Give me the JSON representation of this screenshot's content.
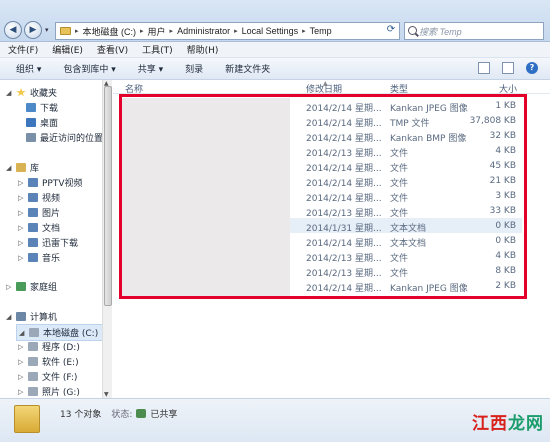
{
  "address": {
    "crumbs": [
      "本地磁盘 (C:)",
      "用户",
      "Administrator",
      "Local Settings",
      "Temp"
    ],
    "search_placeholder": "搜索 Temp"
  },
  "menu": [
    "文件(F)",
    "编辑(E)",
    "查看(V)",
    "工具(T)",
    "帮助(H)"
  ],
  "toolbar": [
    "组织 ▾",
    "包含到库中 ▾",
    "共享 ▾",
    "刻录",
    "新建文件夹"
  ],
  "columns": {
    "name": "名称",
    "date": "修改日期",
    "type": "类型",
    "size": "大小"
  },
  "nav": {
    "favorites": "收藏夹",
    "downloads": "下载",
    "desktop": "桌面",
    "recent": "最近访问的位置",
    "libraries": "库",
    "pptv": "PPTV视频",
    "videos": "视频",
    "pictures": "图片",
    "documents": "文档",
    "thunder": "迅雷下载",
    "music": "音乐",
    "homegroup": "家庭组",
    "computer": "计算机",
    "drive_c": "本地磁盘 (C:)",
    "drive_d": "程序 (D:)",
    "drive_e": "软件 (E:)",
    "drive_f": "文件 (F:)",
    "drive_g": "照片 (G:)"
  },
  "files": [
    {
      "date": "2014/2/14 星期...",
      "type": "Kankan JPEG 图像",
      "size": "1 KB"
    },
    {
      "date": "2014/2/14 星期...",
      "type": "TMP 文件",
      "size": "37,808 KB"
    },
    {
      "date": "2014/2/14 星期...",
      "type": "Kankan BMP 图像",
      "size": "32 KB"
    },
    {
      "date": "2014/2/13 星期...",
      "type": "文件",
      "size": "4 KB"
    },
    {
      "date": "2014/2/14 星期...",
      "type": "文件",
      "size": "45 KB"
    },
    {
      "date": "2014/2/14 星期...",
      "type": "文件",
      "size": "21 KB"
    },
    {
      "date": "2014/2/14 星期...",
      "type": "文件",
      "size": "3 KB"
    },
    {
      "date": "2014/2/13 星期...",
      "type": "文件",
      "size": "33 KB"
    },
    {
      "date": "2014/1/31 星期...",
      "type": "文本文档",
      "size": "0 KB"
    },
    {
      "date": "2014/2/14 星期...",
      "type": "文本文档",
      "size": "0 KB"
    },
    {
      "date": "2014/2/13 星期...",
      "type": "文件",
      "size": "4 KB"
    },
    {
      "date": "2014/2/13 星期...",
      "type": "文件",
      "size": "8 KB"
    },
    {
      "date": "2014/2/14 星期...",
      "type": "Kankan JPEG 图像",
      "size": "2 KB"
    }
  ],
  "status": {
    "count": "13 个对象",
    "state_label": "状态:",
    "state_value": "已共享"
  },
  "watermark": {
    "part1": "江西",
    "part2": "龙网"
  },
  "colors": {
    "highlight": "#e3002a",
    "selected_row": "#e6eef8"
  }
}
